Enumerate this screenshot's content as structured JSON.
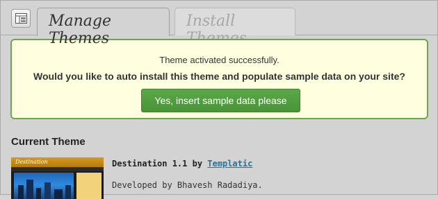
{
  "tabs": [
    {
      "label": "Manage Themes",
      "active": true
    },
    {
      "label": "Install Themes",
      "active": false
    }
  ],
  "header_icon": "themes-icon",
  "notice": {
    "status": "Theme activated successfully.",
    "question": "Would you like to auto install this theme and populate sample data on your site?",
    "button_label": "Yes, insert sample data please"
  },
  "current_theme": {
    "section_title": "Current Theme",
    "name_version": "Destination 1.1",
    "by": "by",
    "author_link": "Templatic",
    "developed_by": "Developed by Bhavesh Radadiya.",
    "thumbnail_logo": "Destination"
  },
  "colors": {
    "notice_bg": "#ffffe0",
    "notice_border": "#6aa64b",
    "button_green": "#4a9339",
    "link": "#21759b"
  }
}
